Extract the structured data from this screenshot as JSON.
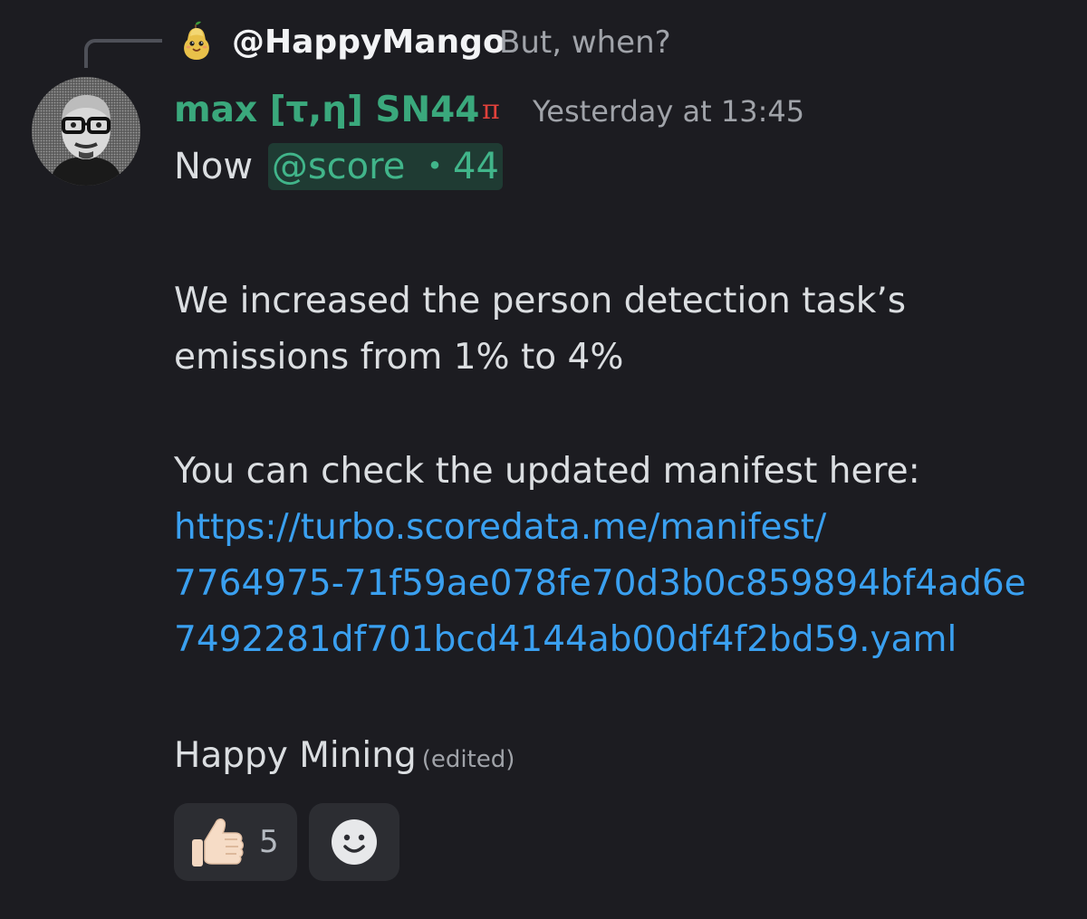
{
  "reply": {
    "author": "@HappyMango",
    "text": "But, when?",
    "avatar_icon": "pear-character-icon"
  },
  "message": {
    "author": "max [τ,η] SN44",
    "role_icon": "π",
    "timestamp": "Yesterday at 13:45",
    "line1_prefix": "Now",
    "mention": "@score ・44",
    "paragraph1_line1": "We increased the person detection task’s",
    "paragraph1_line2": "emissions from 1% to 4%",
    "paragraph2": "You can check the updated manifest here:",
    "link_line1": "https://turbo.scoredata.me/manifest/",
    "link_line2": "7764975-71f59ae078fe70d3b0c859894bf4ad6e",
    "link_line3": "7492281df701bcd4144ab00df4f2bd59.yaml",
    "closing": "Happy Mining",
    "edited": "(edited)"
  },
  "reactions": [
    {
      "emoji": "thumbs-up-icon",
      "count": "5"
    }
  ],
  "add_reaction_icon": "smiley-icon",
  "colors": {
    "background": "#1c1c21",
    "author": "#3aa87c",
    "mention_bg": "#1f3b33",
    "mention_text": "#41b58a",
    "link": "#3aa0f0",
    "muted": "#a0a3a9",
    "role_icon": "#e0413b"
  }
}
